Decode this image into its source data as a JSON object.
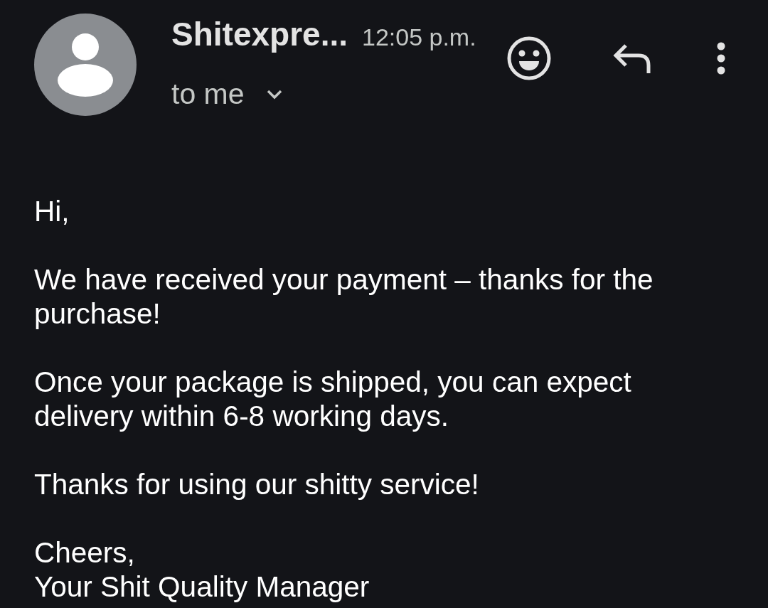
{
  "header": {
    "sender": "Shitexpre...",
    "time": "12:05 p.m.",
    "recipients": {
      "label": "to me",
      "expanded": false
    }
  },
  "body": {
    "paragraphs": [
      "Hi,",
      "We have received your payment – thanks for the purchase!",
      "Once your package is shipped, you can expect delivery within 6-8 working days.",
      "Thanks for using our shitty service!"
    ],
    "signature": [
      "Cheers,",
      "Your Shit Quality Manager"
    ]
  }
}
